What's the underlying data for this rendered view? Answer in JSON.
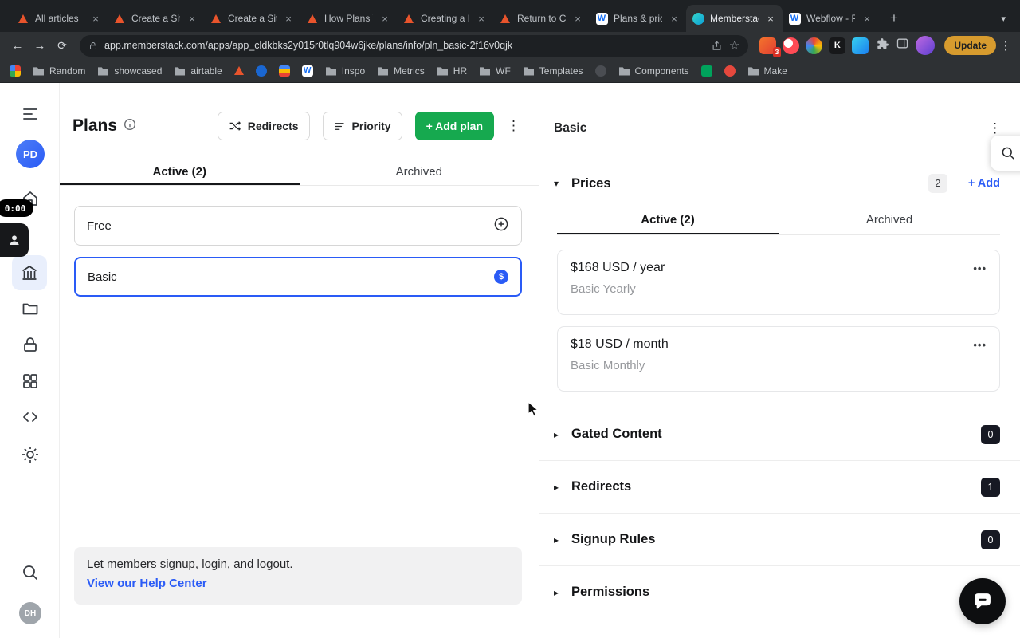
{
  "browser": {
    "tabs": [
      {
        "label": "All articles"
      },
      {
        "label": "Create a Site"
      },
      {
        "label": "Create a Site"
      },
      {
        "label": "How Plans W"
      },
      {
        "label": "Creating a P"
      },
      {
        "label": "Return to Ch"
      },
      {
        "label": "Plans & pric"
      },
      {
        "label": "Memberstac"
      },
      {
        "label": "Webflow - P"
      }
    ],
    "address": {
      "url": "app.memberstack.com/apps/app_cldkbks2y015r0tlq904w6jke/plans/info/pln_basic-2f16v0qjk"
    },
    "extensions_badge": "3",
    "update_label": "Update",
    "bookmarks": {
      "random": "Random",
      "showcased": "showcased",
      "airtable": "airtable",
      "inspo": "Inspo",
      "metrics": "Metrics",
      "hr": "HR",
      "wf": "WF",
      "templates": "Templates",
      "components": "Components",
      "make": "Make"
    }
  },
  "recorder": {
    "timer": "0:00"
  },
  "rail": {
    "profile_initials": "PD",
    "account_initials": "DH"
  },
  "plans_panel": {
    "title": "Plans",
    "redirects_button": "Redirects",
    "priority_button": "Priority",
    "add_plan_button": "+ Add plan",
    "tab_active": "Active (2)",
    "tab_archived": "Archived",
    "plans": [
      {
        "name": "Free"
      },
      {
        "name": "Basic"
      }
    ],
    "help_text": "Let members signup, login, and logout.",
    "help_link": "View our Help Center"
  },
  "detail_panel": {
    "title": "Basic",
    "prices_label": "Prices",
    "prices_count": "2",
    "add_price_label": "+ Add",
    "tab_active": "Active (2)",
    "tab_archived": "Archived",
    "prices": [
      {
        "amount": "$168 USD / year",
        "name": "Basic Yearly"
      },
      {
        "amount": "$18 USD / month",
        "name": "Basic Monthly"
      }
    ],
    "sections": [
      {
        "label": "Gated Content",
        "count": "0"
      },
      {
        "label": "Redirects",
        "count": "1"
      },
      {
        "label": "Signup Rules",
        "count": "0"
      },
      {
        "label": "Permissions",
        "count": ""
      }
    ]
  },
  "colors": {
    "accent_blue": "#2a5bf6",
    "accent_green": "#16a94f",
    "badge_dark": "#171923"
  }
}
